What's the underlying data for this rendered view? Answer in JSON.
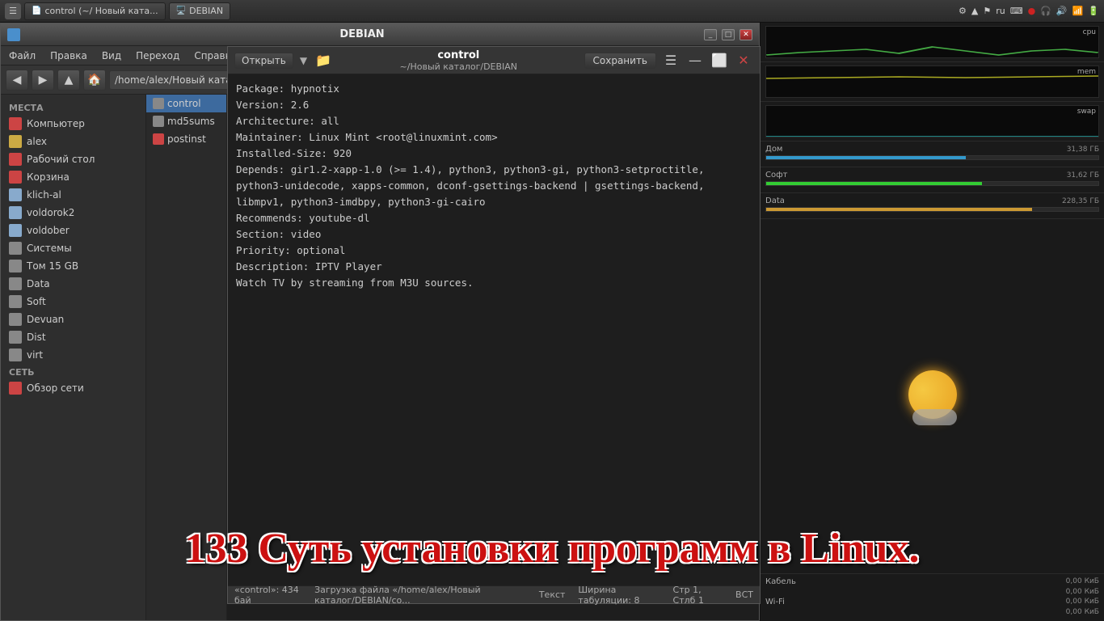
{
  "taskbar": {
    "buttons": [
      {
        "label": "control (~/ Новый ката...",
        "active": false
      },
      {
        "label": "DEBIAN",
        "active": true
      }
    ],
    "tray": {
      "lang": "ru",
      "time": "",
      "volume": "🔊",
      "net": "🌐"
    }
  },
  "filemanager": {
    "title": "DEBIAN",
    "menubar": [
      "Файл",
      "Правка",
      "Вид",
      "Переход",
      "Справка"
    ],
    "path": "/home/alex/Новый каталог/DEBI",
    "sidebar": {
      "sections": [
        {
          "header": "Места",
          "items": [
            {
              "label": "Компьютер",
              "color": "#cc4444"
            },
            {
              "label": "alex",
              "color": "#ccaa44"
            },
            {
              "label": "Рабочий стол",
              "color": "#cc4444"
            },
            {
              "label": "Корзина",
              "color": "#cc4444"
            },
            {
              "label": "klich-al",
              "color": "#88aacc"
            },
            {
              "label": "voldorok2",
              "color": "#88aacc"
            },
            {
              "label": "voldober",
              "color": "#88aacc"
            },
            {
              "label": "Системы",
              "color": "#88aacc"
            },
            {
              "label": "Том 15 GB",
              "color": "#888"
            },
            {
              "label": "Data",
              "color": "#888"
            },
            {
              "label": "Soft",
              "color": "#888"
            },
            {
              "label": "Devuan",
              "color": "#888"
            },
            {
              "label": "Dist",
              "color": "#888"
            },
            {
              "label": "virt",
              "color": "#888"
            }
          ]
        },
        {
          "header": "Сеть",
          "items": [
            {
              "label": "Обзор сети",
              "color": "#cc4444"
            }
          ]
        }
      ]
    },
    "files": [
      {
        "name": "control",
        "selected": true
      },
      {
        "name": "md5sums",
        "selected": false
      },
      {
        "name": "postinst",
        "selected": false
      }
    ],
    "statusbar": {
      "info": "«control»: 434 бай",
      "file_info": "Загрузка файла «/home/alex/Новый каталог/DEBIAN/co...",
      "encoding": "Текст",
      "tab_width": "Ширина табуляции: 8",
      "cursor": "Стр 1, Стлб 1",
      "mode": "ВСТ"
    }
  },
  "editor": {
    "title": "control",
    "path": "~/Новый каталог/DEBIAN",
    "save_label": "Сохранить",
    "open_label": "Открыть",
    "content_lines": [
      "Package: hypnotix",
      "Version: 2.6",
      "Architecture: all",
      "Maintainer: Linux Mint <root@linuxmint.com>",
      "Installed-Size: 920",
      "Depends: gir1.2-xapp-1.0 (>= 1.4), python3, python3-gi, python3-setproctitle, python3-unidecode, xapps-common, dconf-gsettings-backend | gsettings-backend, libmpv1, python3-imdbpy, python3-gi-cairo",
      "Recommends: youtube-dl",
      "Section: video",
      "Priority: optional",
      "Description: IPTV Player",
      " Watch TV by streaming from M3U sources."
    ]
  },
  "monitor": {
    "cpu": {
      "label": "cpu",
      "bar_pct": 15,
      "color": "#44aa44"
    },
    "mem": {
      "label": "mem",
      "bar_pct": 70,
      "color": "#aaaa22"
    },
    "swap": {
      "label": "swap",
      "bar_pct": 5,
      "color": "#22aaaa"
    },
    "disks": [
      {
        "label": "Дом",
        "value": "31,38 ГБ",
        "pct": 60,
        "color": "#3399cc"
      },
      {
        "label": "Софт",
        "value": "31,62 ГБ",
        "pct": 65,
        "color": "#33cc33"
      },
      {
        "label": "Data",
        "value": "228,35 ГБ",
        "pct": 80,
        "color": "#cc9933"
      }
    ]
  },
  "network": {
    "cable_label": "Кабель",
    "cable_val": "0,00 КиБ",
    "val2": "0,00 КиБ",
    "wifi_label": "Wi-Fi",
    "wifi_val": "0,00 КиБ",
    "val4": "0,00 КиБ"
  },
  "overlay": {
    "title": "133 Суть установки программ в Linux."
  }
}
